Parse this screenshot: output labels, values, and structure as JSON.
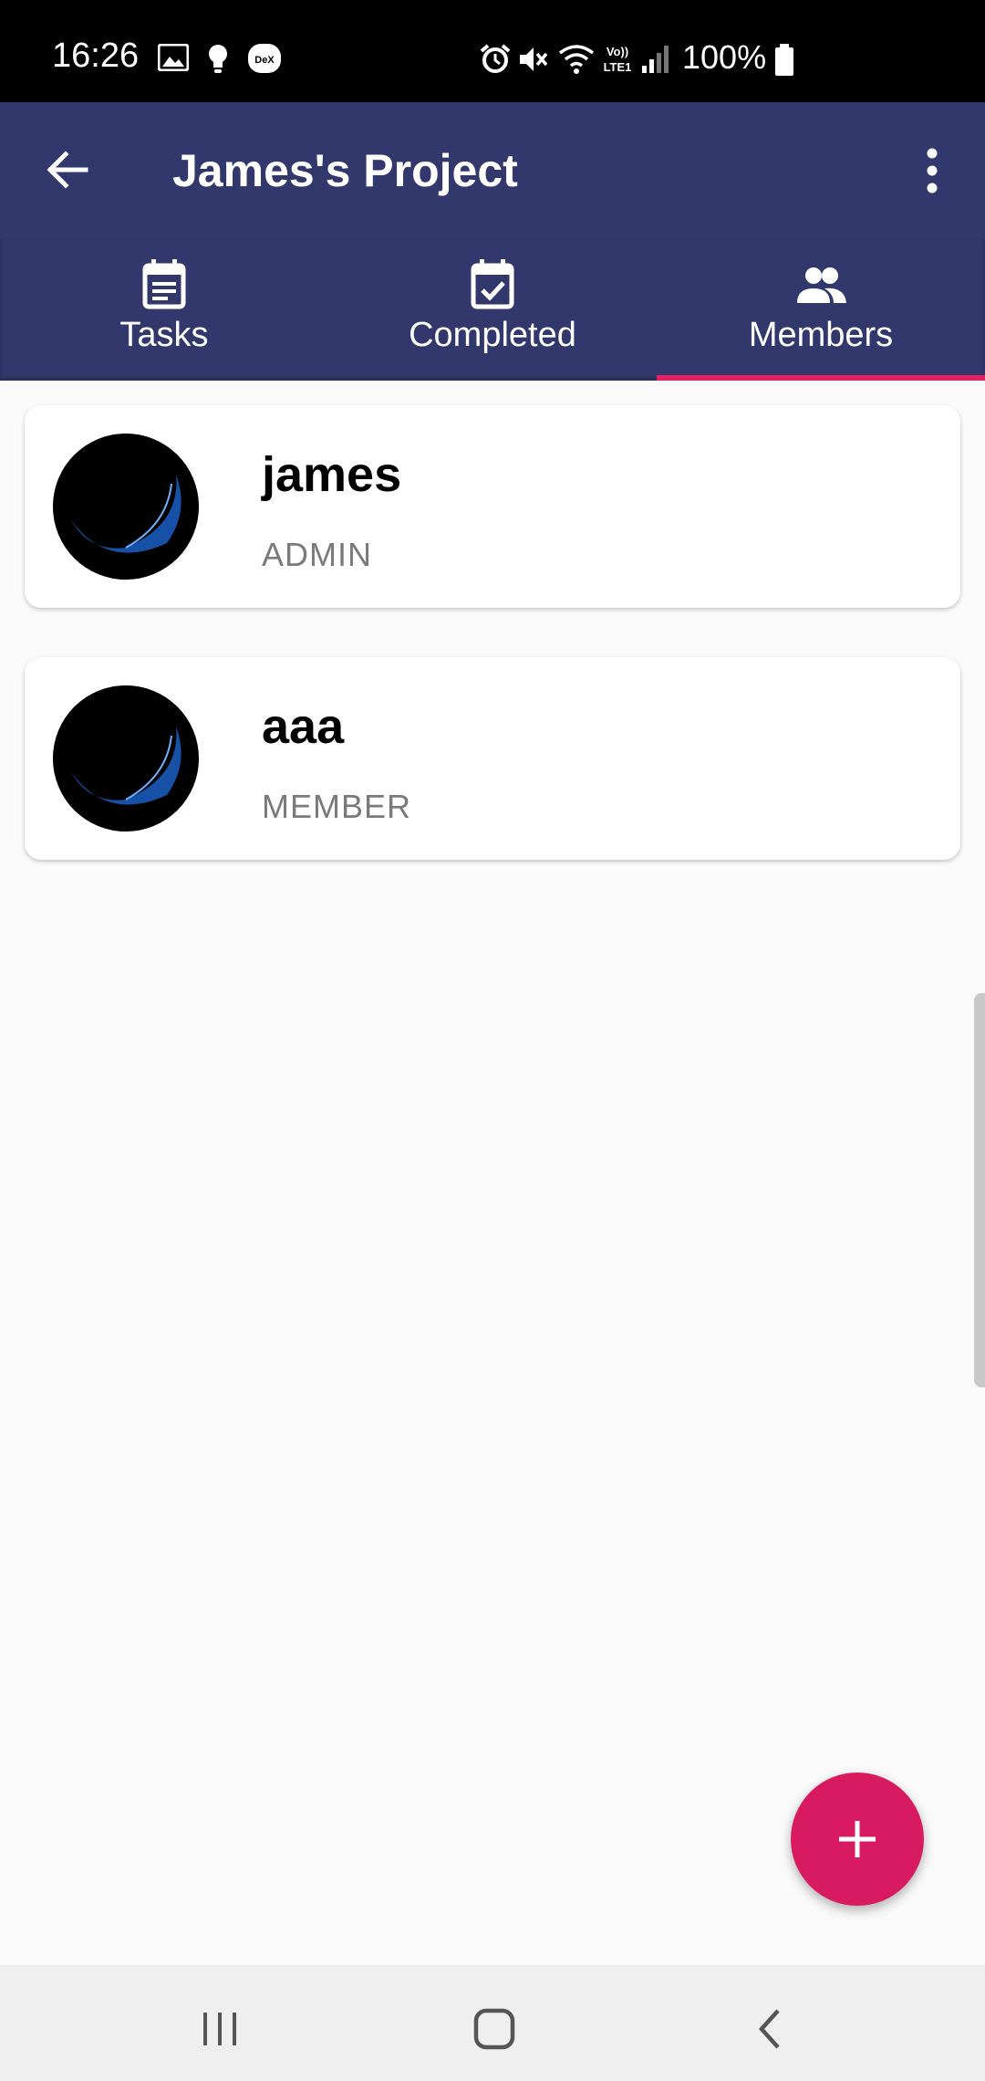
{
  "status_bar": {
    "time": "16:26",
    "battery_text": "100%",
    "icons": [
      "image-icon",
      "bulb-icon",
      "dex-icon",
      "alarm-icon",
      "mute-icon",
      "wifi-icon",
      "volte-icon",
      "signal-icon",
      "battery-icon"
    ],
    "dex_label": "DeX",
    "volte_label": "Vo)) LTE1"
  },
  "app_bar": {
    "title": "James's Project",
    "icons": [
      "back-arrow-icon",
      "more-vert-icon"
    ]
  },
  "tabs": [
    {
      "label": "Tasks",
      "icon": "calendar-list-icon",
      "selected": false
    },
    {
      "label": "Completed",
      "icon": "calendar-check-icon",
      "selected": false
    },
    {
      "label": "Members",
      "icon": "people-icon",
      "selected": true
    }
  ],
  "members": [
    {
      "name": "james",
      "role": "ADMIN"
    },
    {
      "name": "aaa",
      "role": "MEMBER"
    }
  ],
  "fab": {
    "icon": "plus-icon"
  },
  "nav_bar": {
    "icons": [
      "recents-icon",
      "home-icon",
      "back-icon"
    ]
  },
  "colors": {
    "primary": "#32386c",
    "accent": "#d81b60",
    "indicator": "#e91e63",
    "background": "#fafafa"
  }
}
